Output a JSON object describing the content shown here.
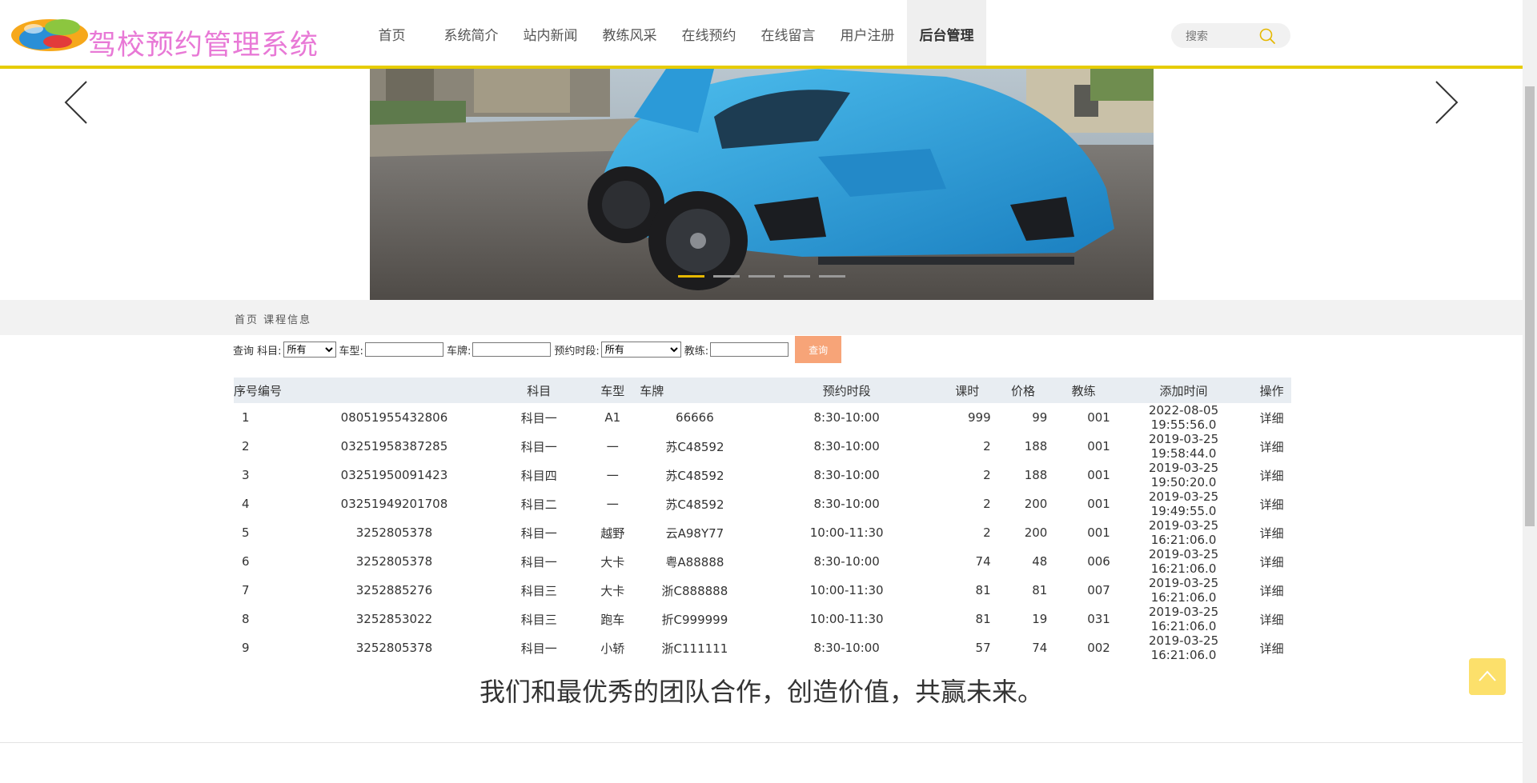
{
  "header": {
    "site_title": "驾校预约管理系统",
    "nav": [
      "首页",
      "系统简介",
      "站内新闻",
      "教练风采",
      "在线预约",
      "在线留言",
      "用户注册",
      "后台管理"
    ],
    "active_nav": "后台管理",
    "search_placeholder": "搜索"
  },
  "carousel": {
    "slide_count": 5,
    "active_index": 0
  },
  "breadcrumb": "首页 课程信息",
  "query": {
    "prefix": "查询",
    "subject_label": "科目:",
    "subject_value": "所有",
    "cartype_label": "车型:",
    "plate_label": "车牌:",
    "slot_label": "预约时段:",
    "slot_value": "所有",
    "coach_label": "教练:",
    "button": "查询"
  },
  "table": {
    "headers": [
      "序号",
      "编号",
      "科目",
      "车型",
      "车牌",
      "预约时段",
      "课时",
      "价格",
      "教练",
      "添加时间",
      "操作"
    ],
    "rows": [
      [
        "1",
        "08051955432806",
        "科目一",
        "A1",
        "66666",
        "8:30-10:00",
        "999",
        "99",
        "001",
        "2022-08-05 19:55:56.0",
        "详细"
      ],
      [
        "2",
        "03251958387285",
        "科目一",
        "一",
        "苏C48592",
        "8:30-10:00",
        "2",
        "188",
        "001",
        "2019-03-25 19:58:44.0",
        "详细"
      ],
      [
        "3",
        "03251950091423",
        "科目四",
        "一",
        "苏C48592",
        "8:30-10:00",
        "2",
        "188",
        "001",
        "2019-03-25 19:50:20.0",
        "详细"
      ],
      [
        "4",
        "03251949201708",
        "科目二",
        "一",
        "苏C48592",
        "8:30-10:00",
        "2",
        "200",
        "001",
        "2019-03-25 19:49:55.0",
        "详细"
      ],
      [
        "5",
        "3252805378",
        "科目一",
        "越野",
        "云A98Y77",
        "10:00-11:30",
        "2",
        "200",
        "001",
        "2019-03-25 16:21:06.0",
        "详细"
      ],
      [
        "6",
        "3252805378",
        "科目一",
        "大卡",
        "粤A88888",
        "8:30-10:00",
        "74",
        "48",
        "006",
        "2019-03-25 16:21:06.0",
        "详细"
      ],
      [
        "7",
        "3252885276",
        "科目三",
        "大卡",
        "浙C888888",
        "10:00-11:30",
        "81",
        "81",
        "007",
        "2019-03-25 16:21:06.0",
        "详细"
      ],
      [
        "8",
        "3252853022",
        "科目三",
        "跑车",
        "折C999999",
        "10:00-11:30",
        "81",
        "19",
        "031",
        "2019-03-25 16:21:06.0",
        "详细"
      ],
      [
        "9",
        "3252805378",
        "科目一",
        "小轿",
        "浙C111111",
        "8:30-10:00",
        "57",
        "74",
        "002",
        "2019-03-25 16:21:06.0",
        "详细"
      ]
    ]
  },
  "slogan": "我们和最优秀的团队合作，创造价值，共赢未来。",
  "colors": {
    "accent": "#e6cc00",
    "title_pink": "#e879d6",
    "button": "#f7a478",
    "back_top": "#fce06b"
  }
}
